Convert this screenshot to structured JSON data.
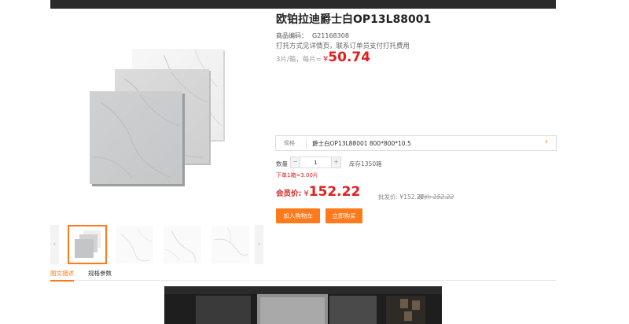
{
  "product": {
    "title": "欧铂拉迪爵士白OP13L88001",
    "code_label": "商品编码：",
    "code": "G21168308",
    "shipping_note": "打托方式见详情页，联系订单员支付打托费用",
    "unit_label": "3片/箱，每片=",
    "unit_currency": "¥",
    "unit_price": "50.74"
  },
  "spec": {
    "label": "规格",
    "value": "爵士白OP13L88001 800*800*10.5"
  },
  "quantity": {
    "label": "数量",
    "value": "1",
    "minus": "−",
    "plus": "+",
    "stock": "库存1350箱",
    "min_order": "下单1箱=3.00片"
  },
  "pricing": {
    "member_label": "会员价:",
    "member_currency": "¥",
    "member_price": "152.22",
    "wholesale": "批发价: ¥152.22",
    "market": "原价: 152.22"
  },
  "actions": {
    "add_to_cart": "加入购物车",
    "buy_now": "立即购买"
  },
  "thumbnails": {
    "prev": "‹",
    "next": "›"
  },
  "tabs": [
    {
      "label": "图文描述",
      "active": true
    },
    {
      "label": "规格参数",
      "active": false
    }
  ],
  "colors": {
    "accent": "#ff7a1a",
    "price": "#e02020"
  }
}
